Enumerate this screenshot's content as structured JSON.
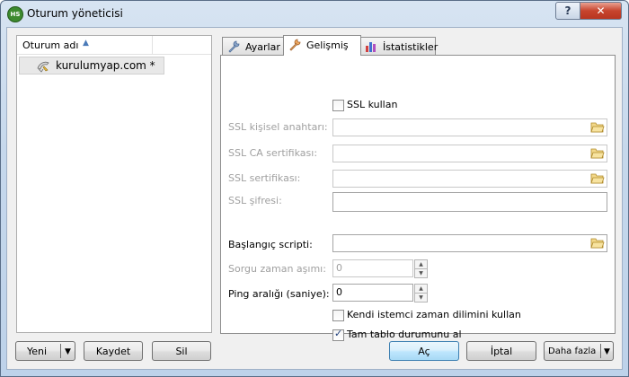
{
  "window": {
    "title": "Oturum yöneticisi",
    "app_icon_text": "HS",
    "help_label": "?",
    "close_label": "✕"
  },
  "session_list": {
    "column_header": "Oturum adı",
    "sort_icon": "sort-up-icon",
    "items": [
      {
        "label": "kurulumyap.com *",
        "icon": "dolphin-icon"
      }
    ]
  },
  "tabs": [
    {
      "label": "Ayarlar",
      "icon": "wrench-icon",
      "active": false
    },
    {
      "label": "Gelişmiş",
      "icon": "wrench-orange-icon",
      "active": true
    },
    {
      "label": "İstatistikler",
      "icon": "bar-chart-icon",
      "active": false
    }
  ],
  "advanced": {
    "ssl_use_label": "SSL kullan",
    "ssl_use_checked": false,
    "ssl_private_key_label": "SSL kişisel anahtarı:",
    "ssl_private_key_value": "",
    "ssl_ca_cert_label": "SSL CA sertifikası:",
    "ssl_ca_cert_value": "",
    "ssl_cert_label": "SSL sertifikası:",
    "ssl_cert_value": "",
    "ssl_password_label": "SSL şifresi:",
    "ssl_password_value": "",
    "startup_script_label": "Başlangıç scripti:",
    "startup_script_value": "",
    "query_timeout_label": "Sorgu zaman aşımı:",
    "query_timeout_value": "0",
    "ping_interval_label": "Ping aralığı (saniye):",
    "ping_interval_value": "0",
    "local_tz_label": "Kendi istemci zaman dilimini kullan",
    "local_tz_checked": false,
    "full_table_status_label": "Tam tablo durumunu al",
    "full_table_status_checked": true
  },
  "buttons": {
    "new_label": "Yeni",
    "save_label": "Kaydet",
    "delete_label": "Sil",
    "open_label": "Aç",
    "cancel_label": "İptal",
    "more_label": "Daha fazla"
  },
  "colors": {
    "accent_blue": "#3c7fb1",
    "close_red": "#c7442d",
    "disabled_text": "#a0a0a0"
  }
}
